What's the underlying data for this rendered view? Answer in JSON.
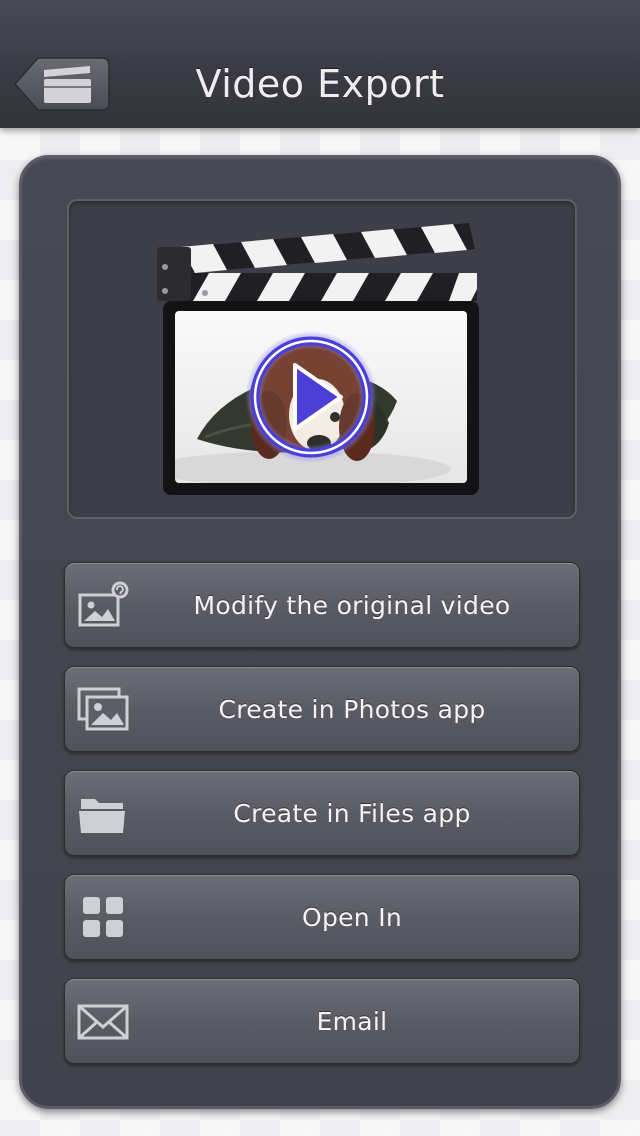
{
  "navbar": {
    "title": "Video Export",
    "back_button_icon": "clapperboard-icon"
  },
  "preview": {
    "thumbnail": "clapperboard with dog video thumbnail",
    "overlay_icon": "play-icon"
  },
  "actions": [
    {
      "label": "Modify the original video",
      "icon": "photo-edit-icon"
    },
    {
      "label": "Create in Photos app",
      "icon": "photos-icon"
    },
    {
      "label": "Create in Files app",
      "icon": "folder-icon"
    },
    {
      "label": "Open In",
      "icon": "grid-icon"
    },
    {
      "label": "Email",
      "icon": "envelope-icon"
    }
  ],
  "colors": {
    "navbar": "#3b3b45",
    "panel": "#44444e",
    "button": "#5d5d67",
    "play_ring": "#4b3fd6"
  }
}
